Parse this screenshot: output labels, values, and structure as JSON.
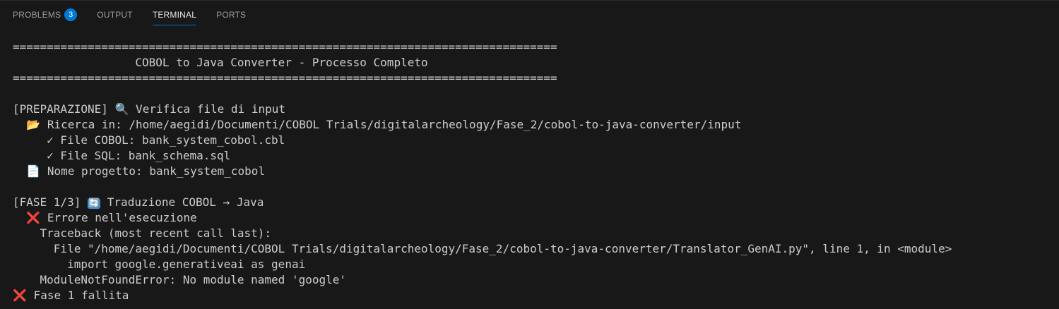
{
  "tabs": [
    {
      "label": "PROBLEMS",
      "badge": "3"
    },
    {
      "label": "OUTPUT"
    },
    {
      "label": "TERMINAL"
    },
    {
      "label": "PORTS"
    }
  ],
  "active_tab": "TERMINAL",
  "terminal": {
    "lines": [
      {
        "text": "================================================================================"
      },
      {
        "text": "                  COBOL to Java Converter - Processo Completo"
      },
      {
        "text": "================================================================================"
      },
      {
        "text": ""
      },
      {
        "pre": "[PREPARAZIONE] ",
        "icon": "🔍",
        "icon_name": "magnifier-icon",
        "text": " Verifica file di input"
      },
      {
        "pre": "  ",
        "icon": "📂",
        "icon_name": "open-folder-icon",
        "text": " Ricerca in: /home/aegidi/Documenti/COBOL Trials/digitalarcheology/Fase_2/cobol-to-java-converter/input"
      },
      {
        "text": "     ✓ File COBOL: bank_system_cobol.cbl"
      },
      {
        "text": "     ✓ File SQL: bank_schema.sql"
      },
      {
        "pre": "  ",
        "icon": "📄",
        "icon_name": "document-icon",
        "text": " Nome progetto: bank_system_cobol"
      },
      {
        "text": ""
      },
      {
        "pre": "[FASE 1/3] ",
        "icon": "🔄",
        "icon_name": "refresh-icon",
        "text": " Traduzione COBOL → Java"
      },
      {
        "pre": "  ",
        "icon": "❌",
        "icon_name": "cross-mark-icon",
        "text": " Errore nell'esecuzione"
      },
      {
        "text": "    Traceback (most recent call last):"
      },
      {
        "text": "      File \"/home/aegidi/Documenti/COBOL Trials/digitalarcheology/Fase_2/cobol-to-java-converter/Translator_GenAI.py\", line 1, in <module>"
      },
      {
        "text": "        import google.generativeai as genai"
      },
      {
        "text": "    ModuleNotFoundError: No module named 'google'"
      },
      {
        "pre": "",
        "icon": "❌",
        "icon_name": "cross-mark-icon",
        "text": " Fase 1 fallita"
      }
    ]
  },
  "colors": {
    "background": "#181818",
    "text": "#cccccc",
    "accent": "#0078d4",
    "error": "#f14c4c"
  }
}
